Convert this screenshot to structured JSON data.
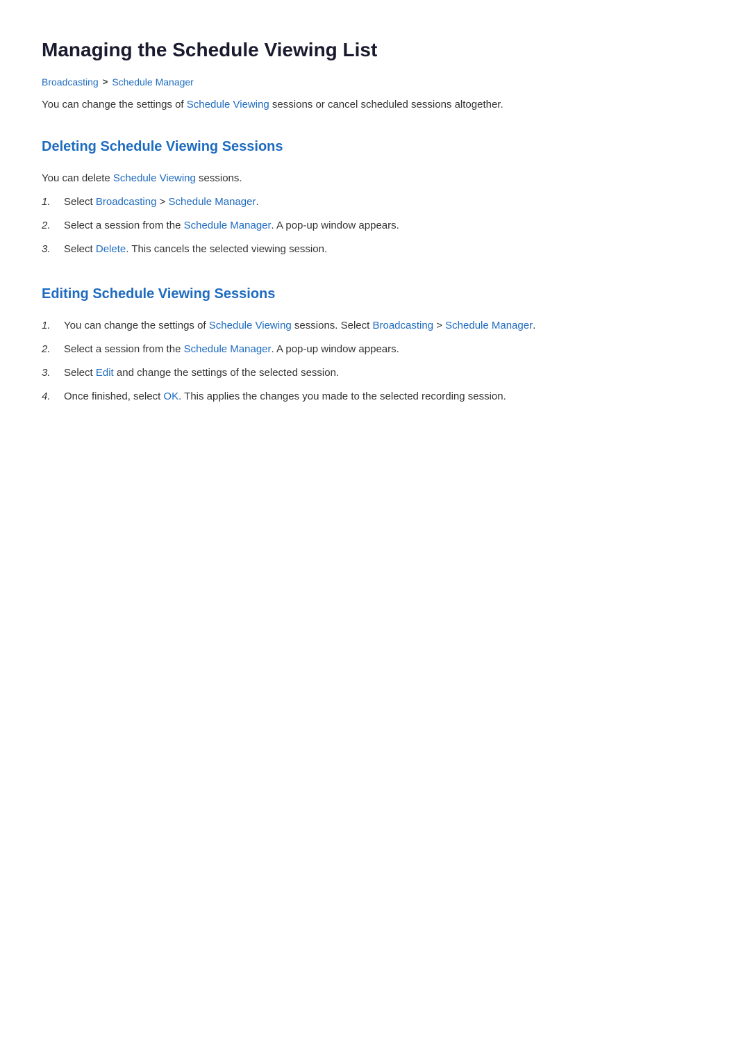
{
  "page": {
    "title": "Managing the Schedule Viewing List",
    "breadcrumb": {
      "items": [
        {
          "label": "Broadcasting",
          "link": true
        },
        {
          "label": "Schedule Manager",
          "link": true
        }
      ],
      "separator": ">"
    },
    "intro": {
      "prefix": "You can change the settings of ",
      "highlight1": "Schedule Viewing",
      "suffix": " sessions or cancel scheduled sessions altogether."
    }
  },
  "sections": [
    {
      "id": "deleting",
      "title": "Deleting Schedule Viewing Sessions",
      "intro": {
        "prefix": "You can delete ",
        "highlight": "Schedule Viewing",
        "suffix": " sessions."
      },
      "steps": [
        {
          "number": "1.",
          "parts": [
            {
              "text": "Select "
            },
            {
              "text": "Broadcasting",
              "highlight": true
            },
            {
              "text": " > "
            },
            {
              "text": "Schedule Manager",
              "highlight": true
            },
            {
              "text": "."
            }
          ]
        },
        {
          "number": "2.",
          "parts": [
            {
              "text": "Select a session from the "
            },
            {
              "text": "Schedule Manager",
              "highlight": true
            },
            {
              "text": ". A pop-up window appears."
            }
          ]
        },
        {
          "number": "3.",
          "parts": [
            {
              "text": "Select "
            },
            {
              "text": "Delete",
              "highlight": true
            },
            {
              "text": ". This cancels the selected viewing session."
            }
          ]
        }
      ]
    },
    {
      "id": "editing",
      "title": "Editing Schedule Viewing Sessions",
      "steps": [
        {
          "number": "1.",
          "parts": [
            {
              "text": "You can change the settings of "
            },
            {
              "text": "Schedule Viewing",
              "highlight": true
            },
            {
              "text": " sessions. Select "
            },
            {
              "text": "Broadcasting",
              "highlight": true
            },
            {
              "text": " > "
            },
            {
              "text": "Schedule Manager",
              "highlight": true
            },
            {
              "text": "."
            }
          ]
        },
        {
          "number": "2.",
          "parts": [
            {
              "text": "Select a session from the "
            },
            {
              "text": "Schedule Manager",
              "highlight": true
            },
            {
              "text": ". A pop-up window appears."
            }
          ]
        },
        {
          "number": "3.",
          "parts": [
            {
              "text": "Select "
            },
            {
              "text": "Edit",
              "highlight": true
            },
            {
              "text": " and change the settings of the selected session."
            }
          ]
        },
        {
          "number": "4.",
          "parts": [
            {
              "text": "Once finished, select "
            },
            {
              "text": "OK",
              "highlight": true
            },
            {
              "text": ". This applies the changes you made to the selected recording session."
            }
          ]
        }
      ]
    }
  ]
}
